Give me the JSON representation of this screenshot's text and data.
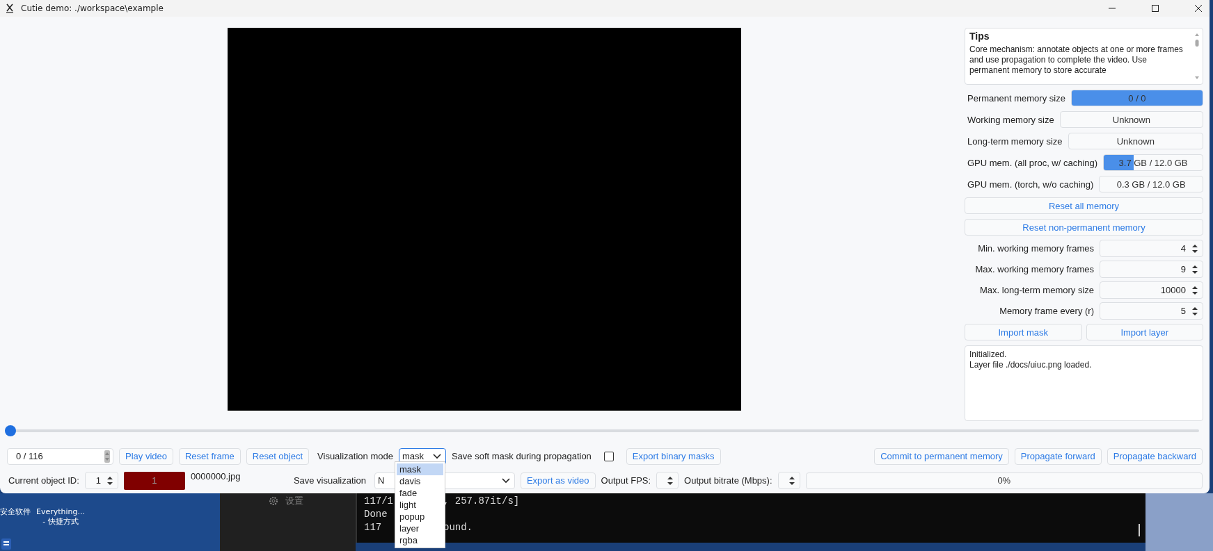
{
  "window": {
    "title": "Cutie demo: ./workspace\\example"
  },
  "tips": {
    "heading": "Tips",
    "text": "Core mechanism: annotate objects at one or more frames and use propagation to complete the video. Use permanent memory to store accurate"
  },
  "memory_stats": [
    {
      "label": "Permanent memory size",
      "reading": "0 / 0",
      "level": 1
    },
    {
      "label": "Working memory size",
      "reading": "Unknown",
      "level": 0
    },
    {
      "label": "Long-term memory size",
      "reading": "Unknown",
      "level": 0
    },
    {
      "label": "GPU mem. (all proc, w/ caching)",
      "reading": "3.7 GB / 12.0 GB",
      "level": 0.3
    },
    {
      "label": "GPU mem. (torch, w/o caching)",
      "reading": "0.3 GB / 12.0 GB",
      "level": 0
    }
  ],
  "reset_buttons": [
    "Reset all memory",
    "Reset non-permanent memory"
  ],
  "settings": [
    {
      "label": "Min. working memory frames",
      "value": "4"
    },
    {
      "label": "Max. working memory frames",
      "value": "9"
    },
    {
      "label": "Max. long-term memory size",
      "value": "10000"
    },
    {
      "label": "Memory frame every (r)",
      "value": "5"
    }
  ],
  "import_buttons": [
    "Import mask",
    "Import layer"
  ],
  "log": [
    "Initialized.",
    "Layer file ./docs/uiuc.png loaded."
  ],
  "timeline": {
    "level": 0
  },
  "frame_field": {
    "value": "0 /  116"
  },
  "playback_buttons": [
    "Play video",
    "Reset frame",
    "Reset object"
  ],
  "visualization_mode": {
    "label": "Visualization mode",
    "value": "mask",
    "expanded": true,
    "options": [
      {
        "label": "mask",
        "selected": true
      },
      {
        "label": "davis",
        "selected": false
      },
      {
        "label": "fade",
        "selected": false
      },
      {
        "label": "light",
        "selected": false
      },
      {
        "label": "popup",
        "selected": false
      },
      {
        "label": "layer",
        "selected": false
      },
      {
        "label": "rgba",
        "selected": false
      }
    ]
  },
  "soft_mask": {
    "label": "Save soft mask during propagation",
    "checked": false
  },
  "export_masks_button": "Export binary masks",
  "propagation_buttons": [
    "Commit to permanent memory",
    "Propagate forward",
    "Propagate backward"
  ],
  "object_id": {
    "label": "Current object ID:",
    "value": "1"
  },
  "object_swatch": {
    "text": "1"
  },
  "frame_name": "0000000.jpg",
  "save_visualization": {
    "label": "Save visualization",
    "value": "N"
  },
  "export_video_button": "Export as video",
  "output_fps": {
    "label": "Output FPS:"
  },
  "output_bitrate": {
    "label": "Output bitrate (Mbps):"
  },
  "progress": {
    "reading": "0%",
    "level": 0
  },
  "desktop": {
    "shortcuts": [
      {
        "lines": [
          "安全软件"
        ]
      },
      {
        "lines": [
          "Everything...",
          "- 快捷方式"
        ]
      }
    ],
    "settings_label": "设置",
    "terminal_lines": [
      [
        "117/1",
        ", 257.87it/s]"
      ],
      [
        "Done"
      ],
      [
        "117",
        "ound."
      ]
    ]
  }
}
